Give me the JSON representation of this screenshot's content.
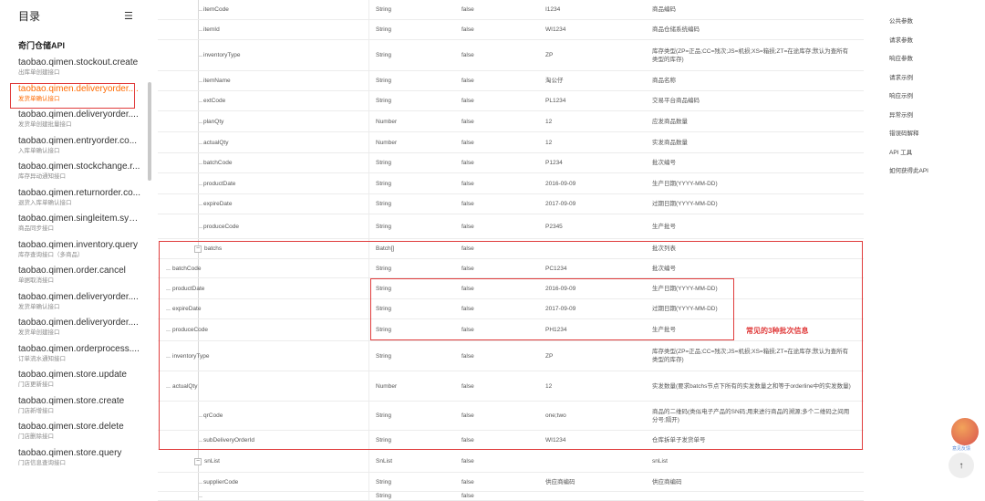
{
  "sidebar": {
    "title": "目录",
    "section": "奇门仓储API",
    "items": [
      {
        "name": "taobao.qimen.stockout.create",
        "desc": "出库单创建接口"
      },
      {
        "name": "taobao.qimen.deliveryorder....",
        "desc": "发货单确认接口"
      },
      {
        "name": "taobao.qimen.deliveryorder....",
        "desc": "发货单创建批量接口"
      },
      {
        "name": "taobao.qimen.entryorder.co...",
        "desc": "入库单确认接口"
      },
      {
        "name": "taobao.qimen.stockchange.r...",
        "desc": "库存异动通知接口"
      },
      {
        "name": "taobao.qimen.returnorder.co...",
        "desc": "退货入库单确认接口"
      },
      {
        "name": "taobao.qimen.singleitem.syn...",
        "desc": "商品同步接口"
      },
      {
        "name": "taobao.qimen.inventory.query",
        "desc": "库存查询接口（多商品）"
      },
      {
        "name": "taobao.qimen.order.cancel",
        "desc": "单据取消接口"
      },
      {
        "name": "taobao.qimen.deliveryorder....",
        "desc": "发货单确认接口"
      },
      {
        "name": "taobao.qimen.deliveryorder....",
        "desc": "发货单创建接口"
      },
      {
        "name": "taobao.qimen.orderprocess....",
        "desc": "订单流水通知接口"
      },
      {
        "name": "taobao.qimen.store.update",
        "desc": "门店更新接口"
      },
      {
        "name": "taobao.qimen.store.create",
        "desc": "门店新增接口"
      },
      {
        "name": "taobao.qimen.store.delete",
        "desc": "门店删除接口"
      },
      {
        "name": "taobao.qimen.store.query",
        "desc": "门店信息查询接口"
      }
    ],
    "active_index": 1
  },
  "table": {
    "rows": [
      {
        "name": "itemCode",
        "type": "String",
        "required": "false",
        "example": "I1234",
        "desc": "商品编码"
      },
      {
        "name": "itemId",
        "type": "String",
        "required": "false",
        "example": "WI1234",
        "desc": "商品仓储系统编码"
      },
      {
        "name": "inventoryType",
        "type": "String",
        "required": "false",
        "example": "ZP",
        "desc": "库存类型(ZP=正品;CC=残次;JS=机损;XS=箱损;ZT=在途库存;默认为查所有类型的库存)"
      },
      {
        "name": "itemName",
        "type": "String",
        "required": "false",
        "example": "淘公仔",
        "desc": "商品名称"
      },
      {
        "name": "extCode",
        "type": "String",
        "required": "false",
        "example": "PL1234",
        "desc": "交易平台商品编码"
      },
      {
        "name": "planQty",
        "type": "Number",
        "required": "false",
        "example": "12",
        "desc": "应发商品数量"
      },
      {
        "name": "actualQty",
        "type": "Number",
        "required": "false",
        "example": "12",
        "desc": "实发商品数量"
      },
      {
        "name": "batchCode",
        "type": "String",
        "required": "false",
        "example": "P1234",
        "desc": "批次编号"
      },
      {
        "name": "productDate",
        "type": "String",
        "required": "false",
        "example": "2016-09-09",
        "desc": "生产日期(YYYY-MM-DD)"
      },
      {
        "name": "expireDate",
        "type": "String",
        "required": "false",
        "example": "2017-09-09",
        "desc": "过期日期(YYYY-MM-DD)"
      },
      {
        "name": "produceCode",
        "type": "String",
        "required": "false",
        "example": "P2345",
        "desc": "生产批号"
      },
      {
        "name": "batchs",
        "type": "Batch[]",
        "required": "false",
        "example": "",
        "desc": "批次列表"
      },
      {
        "name": "batchCode",
        "type": "String",
        "required": "false",
        "example": "PC1234",
        "desc": "批次编号"
      },
      {
        "name": "productDate",
        "type": "String",
        "required": "false",
        "example": "2016-09-09",
        "desc": "生产日期(YYYY-MM-DD)"
      },
      {
        "name": "expireDate",
        "type": "String",
        "required": "false",
        "example": "2017-09-09",
        "desc": "过期日期(YYYY-MM-DD)"
      },
      {
        "name": "produceCode",
        "type": "String",
        "required": "false",
        "example": "PH1234",
        "desc": "生产批号"
      },
      {
        "name": "inventoryType",
        "type": "String",
        "required": "false",
        "example": "ZP",
        "desc": "库存类型(ZP=正品;CC=残次;JS=机损;XS=箱损;ZT=在途库存;默认为查所有类型的库存)"
      },
      {
        "name": "actualQty",
        "type": "Number",
        "required": "false",
        "example": "12",
        "desc": "实发数量(要求batchs节点下所有的实发数量之和等于orderline中的实发数量)"
      },
      {
        "name": "qrCode",
        "type": "String",
        "required": "false",
        "example": "one;two",
        "desc": "商品的二维码(类似电子产品的SN码;用来进行商品的溯源;多个二维码之间用分号;隔开)"
      },
      {
        "name": "subDeliveryOrderId",
        "type": "String",
        "required": "false",
        "example": "WI1234",
        "desc": "仓库拆单子发货单号"
      },
      {
        "name": "snList",
        "type": "SnList",
        "required": "false",
        "example": "",
        "desc": "snList"
      },
      {
        "name": "supplierCode",
        "type": "String",
        "required": "false",
        "example": "供应商编码",
        "desc": "供应商编码"
      },
      {
        "name": "",
        "type": "String",
        "required": "false",
        "example": "",
        "desc": ""
      }
    ]
  },
  "annotation": "常见的3种批次信息",
  "right_nav": {
    "items": [
      "公共参数",
      "请求参数",
      "响应参数",
      "请求示例",
      "响应示例",
      "异常示例",
      "错误码解释",
      "API 工具",
      "如何获得此API"
    ]
  },
  "fab": {
    "label": "意见反馈"
  },
  "colors": {
    "accent": "#ff6a00",
    "highlight": "#e03c3c"
  }
}
